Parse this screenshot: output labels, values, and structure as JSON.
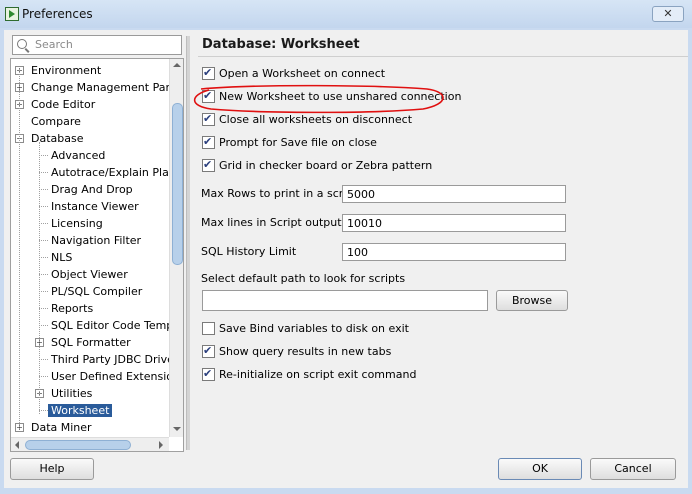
{
  "window": {
    "title": "Preferences",
    "close_glyph": "✕"
  },
  "search": {
    "placeholder": "Search"
  },
  "tree": {
    "items": [
      {
        "label": "Environment",
        "level": 0,
        "expander": "+"
      },
      {
        "label": "Change Management Param",
        "level": 0,
        "expander": "+"
      },
      {
        "label": "Code Editor",
        "level": 0,
        "expander": "+"
      },
      {
        "label": "Compare",
        "level": 0,
        "expander": ""
      },
      {
        "label": "Database",
        "level": 0,
        "expander": "−"
      },
      {
        "label": "Advanced",
        "level": 1,
        "expander": ""
      },
      {
        "label": "Autotrace/Explain Plan",
        "level": 1,
        "expander": ""
      },
      {
        "label": "Drag And Drop",
        "level": 1,
        "expander": ""
      },
      {
        "label": "Instance Viewer",
        "level": 1,
        "expander": ""
      },
      {
        "label": "Licensing",
        "level": 1,
        "expander": ""
      },
      {
        "label": "Navigation Filter",
        "level": 1,
        "expander": ""
      },
      {
        "label": "NLS",
        "level": 1,
        "expander": ""
      },
      {
        "label": "Object Viewer",
        "level": 1,
        "expander": ""
      },
      {
        "label": "PL/SQL Compiler",
        "level": 1,
        "expander": ""
      },
      {
        "label": "Reports",
        "level": 1,
        "expander": ""
      },
      {
        "label": "SQL Editor Code Templa",
        "level": 1,
        "expander": ""
      },
      {
        "label": "SQL Formatter",
        "level": 1,
        "expander": "+"
      },
      {
        "label": "Third Party JDBC Driver",
        "level": 1,
        "expander": ""
      },
      {
        "label": "User Defined Extension",
        "level": 1,
        "expander": ""
      },
      {
        "label": "Utilities",
        "level": 1,
        "expander": "+"
      },
      {
        "label": "Worksheet",
        "level": 1,
        "expander": "",
        "selected": true
      },
      {
        "label": "Data Miner",
        "level": 0,
        "expander": "+"
      }
    ]
  },
  "panel": {
    "heading": "Database: Worksheet",
    "checks_top": [
      {
        "label": "Open a Worksheet on connect",
        "checked": true
      },
      {
        "label": "New Worksheet to use unshared connection",
        "checked": true
      },
      {
        "label": "Close all worksheets on disconnect",
        "checked": true
      },
      {
        "label": "Prompt for Save file on close",
        "checked": true
      },
      {
        "label": "Grid in checker board or Zebra pattern",
        "checked": true
      }
    ],
    "max_rows": {
      "label": "Max Rows to print in a script",
      "value": "5000"
    },
    "max_lines": {
      "label": "Max lines in Script output",
      "value": "10010"
    },
    "sql_history": {
      "label": "SQL History Limit",
      "value": "100"
    },
    "path": {
      "label": "Select default path to look for scripts",
      "value": ""
    },
    "browse_label": "Browse",
    "checks_bottom": [
      {
        "label": "Save Bind variables to disk on exit",
        "checked": false
      },
      {
        "label": "Show query results in new tabs",
        "checked": true
      },
      {
        "label": "Re-initialize on script exit command",
        "checked": true
      }
    ]
  },
  "footer": {
    "help_label": "Help",
    "ok_label": "OK",
    "cancel_label": "Cancel"
  },
  "colors": {
    "selection": "#2a5b9a",
    "annotation": "#e01010",
    "frame": "#c9daf0"
  }
}
